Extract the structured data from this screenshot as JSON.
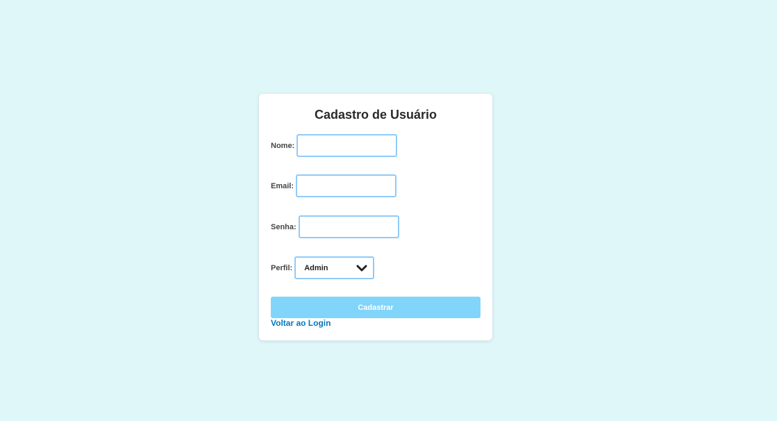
{
  "form": {
    "title": "Cadastro de Usuário",
    "fields": {
      "nome": {
        "label": "Nome:",
        "value": "",
        "placeholder": ""
      },
      "email": {
        "label": "Email:",
        "value": "",
        "placeholder": ""
      },
      "senha": {
        "label": "Senha:",
        "value": "",
        "placeholder": ""
      },
      "perfil": {
        "label": "Perfil:",
        "selected": "Admin",
        "icon": "chevron-down-icon"
      }
    },
    "submit_label": "Cadastrar",
    "back_link_label": "Voltar ao Login"
  },
  "colors": {
    "background": "#e0f7fa",
    "card": "#ffffff",
    "input_border": "#90caf9",
    "button": "#81d4fa",
    "link": "#0277bd"
  }
}
